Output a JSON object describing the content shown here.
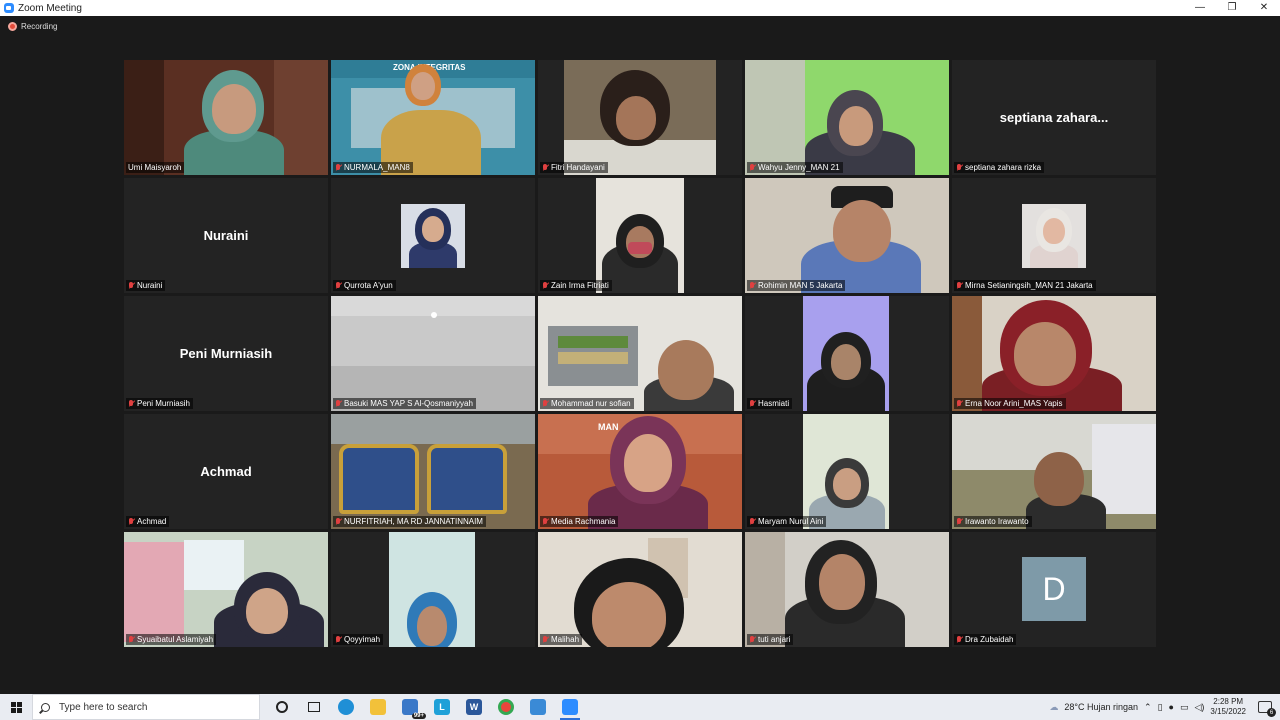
{
  "window": {
    "title": "Zoom Meeting",
    "minimize": "—",
    "maximize": "❐",
    "close": "✕"
  },
  "meeting": {
    "recording_label": "Recording"
  },
  "participants": [
    {
      "name": "Umi Maisyaroh",
      "active": true
    },
    {
      "name": "NURMALA_MAN8",
      "background_text": "ZONA INTEGRITAS"
    },
    {
      "name": "Fitri Handayani"
    },
    {
      "name": "Wahyu Jenny_MAN 21"
    },
    {
      "name": "septiana zahara rizka",
      "display_name": "septiana zahara..."
    },
    {
      "name": "Nuraini",
      "display_name": "Nuraini"
    },
    {
      "name": "Qurrota A'yun"
    },
    {
      "name": "Zain Irma Fitriati"
    },
    {
      "name": "Rohimin MAN 5 Jakarta"
    },
    {
      "name": "Mirna Setianingsih_MAN 21 Jakarta"
    },
    {
      "name": "Peni Murniasih",
      "display_name": "Peni Murniasih"
    },
    {
      "name": "Basuki MAS YAP S Al-Qosmaniyyah"
    },
    {
      "name": "Mohammad nur sofian"
    },
    {
      "name": "Hasmiati"
    },
    {
      "name": "Erna Noor Arini_MAS Yapis"
    },
    {
      "name": "Achmad",
      "display_name": "Achmad"
    },
    {
      "name": "NURFITRIAH, MA RD JANNATINNAIM"
    },
    {
      "name": "Media Rachmania",
      "background_text": "MAN"
    },
    {
      "name": "Maryam Nurul Aini"
    },
    {
      "name": "Irawanto Irawanto"
    },
    {
      "name": "Syuaibatul Aslamiyah"
    },
    {
      "name": "Qoyyimah"
    },
    {
      "name": "Malihah"
    },
    {
      "name": "tuti anjari"
    },
    {
      "name": "Dra Zubaidah",
      "avatar_letter": "D"
    }
  ],
  "taskbar": {
    "search_placeholder": "Type here to search",
    "mail_badge": "99+",
    "weather": "28°C  Hujan ringan",
    "time": "2:28 PM",
    "date": "3/15/2022",
    "notification_count": "6"
  },
  "colors": {
    "active_speaker": "#e6e24c",
    "muted_mic": "#e04040",
    "zoom_blue": "#2d8cff"
  }
}
